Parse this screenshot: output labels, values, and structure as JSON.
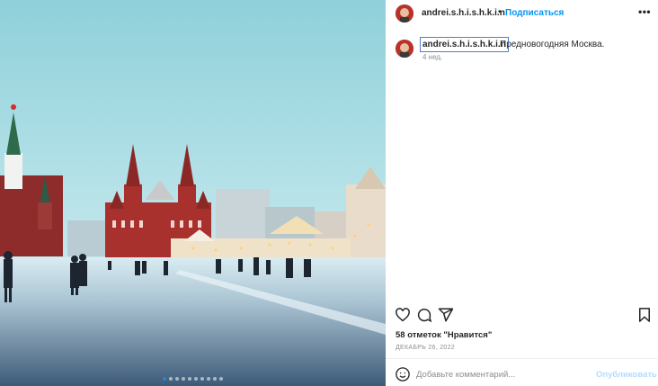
{
  "post": {
    "username": "andrei.s.h.i.s.h.k.i.n",
    "separator": "•",
    "follow_label": "Подписаться",
    "more_label": "•••",
    "caption": {
      "username": "andrei.s.h.i.s.h.k.i.n",
      "text": "Предновогодняя Москва.",
      "time": "4 нед."
    },
    "likes": "58 отметок \"Нравится\"",
    "date": "ДЕКАБРЬ 26, 2022",
    "comment": {
      "placeholder": "Добавьте комментарий...",
      "publish_label": "Опубликовать"
    },
    "photo": {
      "slide_count": 10,
      "active_slide": 1
    }
  },
  "icons": {
    "like": "heart-icon",
    "comment": "comment-bubble-icon",
    "share": "paper-plane-icon",
    "save": "bookmark-icon",
    "emoji": "smiley-icon",
    "more": "more-dots-icon"
  },
  "colors": {
    "accent": "#0095f6",
    "publish_disabled": "#b3dbff",
    "muted_text": "#8e8e8e",
    "active_dot": "#1e88e5"
  }
}
